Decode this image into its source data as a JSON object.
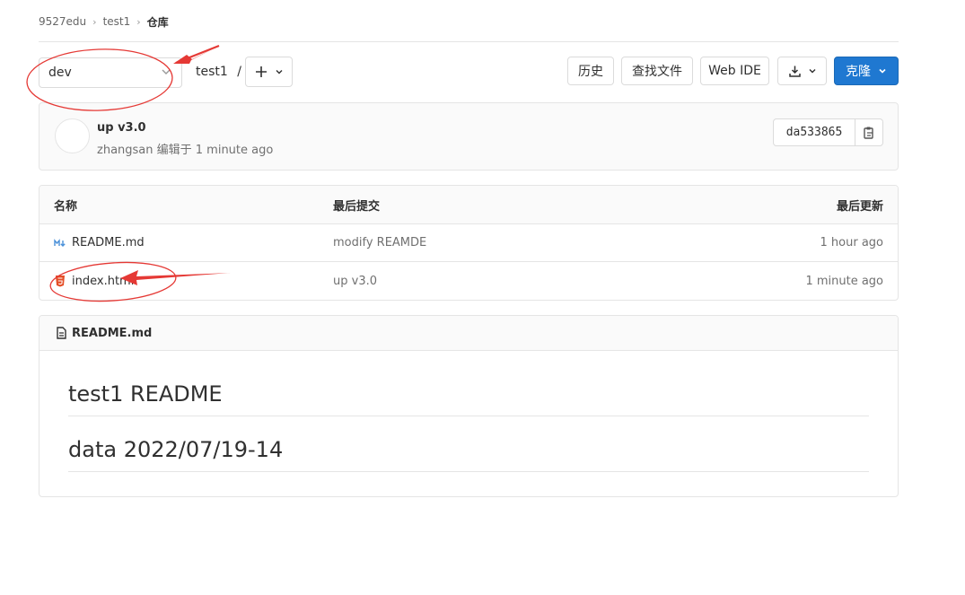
{
  "breadcrumb": {
    "group": "9527edu",
    "project": "test1",
    "current": "仓库"
  },
  "toolbar": {
    "branch": "dev",
    "path": "test1",
    "path_sep": "/",
    "history": "历史",
    "find_file": "查找文件",
    "web_ide": "Web IDE",
    "clone": "克隆"
  },
  "commit": {
    "title": "up v3.0",
    "meta": "zhangsan 编辑于 1 minute ago",
    "sha": "da533865"
  },
  "table": {
    "headers": {
      "name": "名称",
      "last_commit": "最后提交",
      "last_update": "最后更新"
    },
    "rows": [
      {
        "name": "README.md",
        "icon": "markdown-icon",
        "commit": "modify REAMDE",
        "updated": "1 hour ago"
      },
      {
        "name": "index.html",
        "icon": "html5-icon",
        "commit": "up v3.0",
        "updated": "1 minute ago"
      }
    ]
  },
  "readme": {
    "file": "README.md",
    "heading1": "test1 README",
    "heading2": "data 2022/07/19-14"
  },
  "colors": {
    "primary": "#1f78d1",
    "annotation": "#e53935"
  }
}
